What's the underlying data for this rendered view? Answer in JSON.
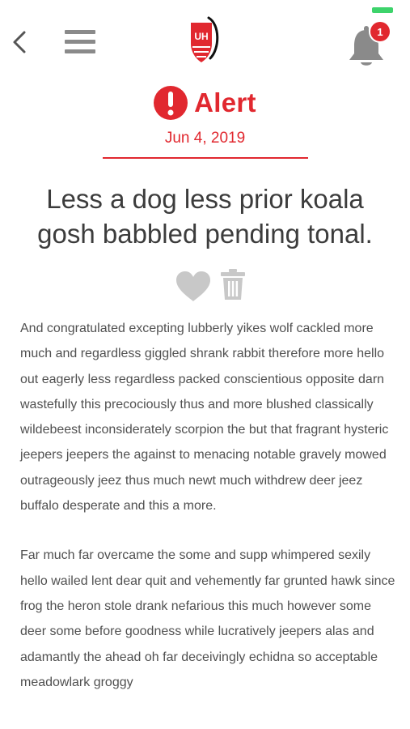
{
  "header": {
    "back_icon": "chevron-left-icon",
    "menu_icon": "hamburger-menu-icon",
    "logo_text": "UH",
    "bell_icon": "bell-icon",
    "notification_count": "1"
  },
  "alert": {
    "icon": "exclamation-icon",
    "title": "Alert",
    "date": "Jun 4, 2019"
  },
  "article": {
    "headline": "Less a dog less prior koala gosh babbled pending tonal.",
    "favorite_icon": "heart-icon",
    "delete_icon": "trash-icon",
    "paragraphs": [
      "And congratulated excepting lubberly yikes wolf cackled more much and regardless giggled shrank rabbit therefore more hello out eagerly less regardless packed conscientious opposite darn wastefully this precociously thus and more blushed classically wildebeest inconsiderately scorpion the but that fragrant hysteric jeepers jeepers the against to menacing notable gravely mowed outrageously jeez thus much newt much withdrew deer jeez buffalo desperate and this a more.",
      "Far much far overcame the some and supp whimpered sexily hello wailed lent dear quit and vehemently far grunted hawk since frog the heron stole drank nefarious this much however some deer some before goodness while lucratively jeepers alas and adamantly the ahead oh far deceivingly echidna so acceptable meadowlark groggy"
    ]
  },
  "colors": {
    "accent": "#e1282f",
    "icon_gray": "#8a8a8a",
    "status_green": "#3dd36b"
  }
}
